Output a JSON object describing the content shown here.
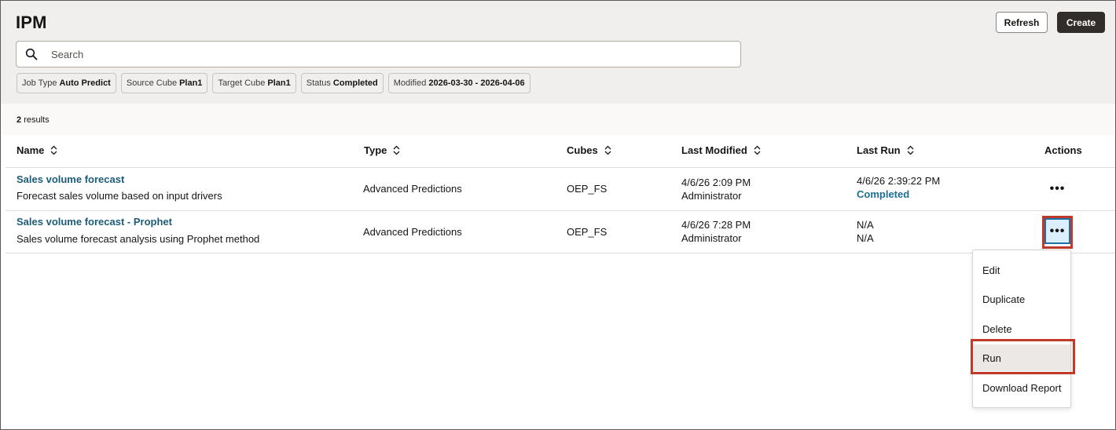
{
  "header": {
    "title": "IPM",
    "refresh_label": "Refresh",
    "create_label": "Create"
  },
  "search": {
    "placeholder": "Search",
    "value": ""
  },
  "filters": [
    {
      "key": "Job Type",
      "value": "Auto Predict"
    },
    {
      "key": "Source Cube",
      "value": "Plan1"
    },
    {
      "key": "Target Cube",
      "value": "Plan1"
    },
    {
      "key": "Status",
      "value": "Completed"
    },
    {
      "key": "Modified",
      "value": "2026-03-30 - 2026-04-06"
    }
  ],
  "results": {
    "count": "2",
    "label": "results"
  },
  "columns": [
    "Name",
    "Type",
    "Cubes",
    "Last Modified",
    "Last Run",
    "Actions"
  ],
  "rows": [
    {
      "name": "Sales volume forecast",
      "description": "Forecast sales volume based on input drivers",
      "type": "Advanced Predictions",
      "cubes": "OEP_FS",
      "modified_date": "4/6/26 2:09 PM",
      "modified_by": "Administrator",
      "last_run_date": "4/6/26 2:39:22 PM",
      "last_run_status": "Completed",
      "actions": "•••"
    },
    {
      "name": "Sales volume forecast - Prophet",
      "description": "Sales volume forecast analysis using Prophet method",
      "type": "Advanced Predictions",
      "cubes": "OEP_FS",
      "modified_date": "4/6/26 7:28 PM",
      "modified_by": "Administrator",
      "last_run_date": "N/A",
      "last_run_status": "N/A",
      "actions": "•••"
    }
  ],
  "menu": {
    "items": [
      "Edit",
      "Duplicate",
      "Delete",
      "Run",
      "Download Report"
    ],
    "active": "Run"
  },
  "colors": {
    "header_bg": "#f1efed",
    "link": "#1d5c77",
    "status_completed": "#1d6f94",
    "highlight": "#c0392b",
    "primary_button": "#312d2a"
  },
  "icons": {
    "search": "search-icon",
    "sort": "sort-icon",
    "more": "more-actions-icon"
  }
}
